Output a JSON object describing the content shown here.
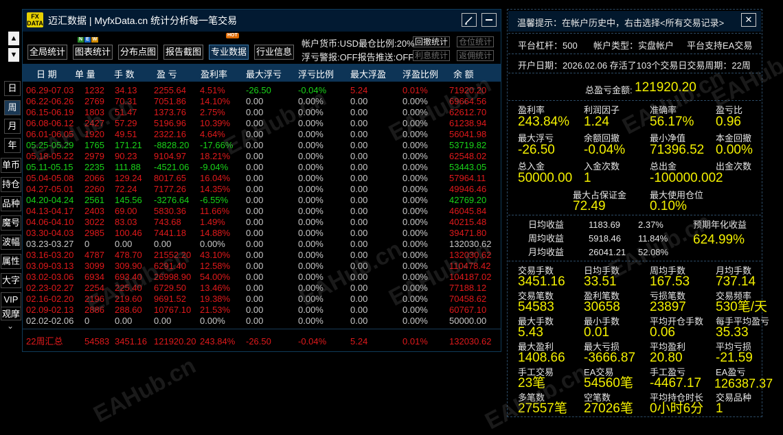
{
  "window": {
    "title": "迈汇数据 | MyfxData.cn  统计分析每一笔交易",
    "logo_text": "FX DATA"
  },
  "toolbar": {
    "buttons": [
      "全局统计",
      "图表统计",
      "分布点图",
      "报告截图",
      "专业数据",
      "行业信息"
    ],
    "new_badge": [
      "N",
      "E",
      "W"
    ],
    "hot_badge": "HOT",
    "currency": "帐户货币:USD最仓比例:20%",
    "warning": "浮亏警报:OFF报告推送:OFF",
    "small_buttons": [
      "回撤统计",
      "仓位统计",
      "利息统计",
      "返佣统计"
    ]
  },
  "sidebar": {
    "up": "▲",
    "down": "▼",
    "items": [
      "日",
      "周",
      "月",
      "年",
      "单币",
      "持仓",
      "品种",
      "魔号",
      "波幅",
      "属性",
      "大字",
      "VIP",
      "观摩"
    ],
    "more": "⌄"
  },
  "table": {
    "headers": [
      "日 期",
      "单 量",
      "手 数",
      "盈 亏",
      "盈利率",
      "最大浮亏",
      "浮亏比例",
      "最大浮盈",
      "浮盈比例",
      "余 额"
    ],
    "rows": [
      {
        "color": "red",
        "date": "06.29-07.03",
        "orders": "1232",
        "lots": "34.13",
        "profit": "2255.64",
        "rate": "4.51%",
        "maxfl": "-26.50",
        "flr": "-0.04%",
        "maxfp": "5.24",
        "fpr": "0.01%",
        "balance": "71920.20"
      },
      {
        "color": "red",
        "date": "06.22-06.26",
        "orders": "2769",
        "lots": "70.31",
        "profit": "7051.86",
        "rate": "14.10%",
        "maxfl": "0.00",
        "flr": "0.00%",
        "maxfp": "0.00",
        "fpr": "0.00%",
        "balance": "69664.56"
      },
      {
        "color": "red",
        "date": "06.15-06.19",
        "orders": "1803",
        "lots": "51.47",
        "profit": "1373.76",
        "rate": "2.75%",
        "maxfl": "0.00",
        "flr": "0.00%",
        "maxfp": "0.00",
        "fpr": "0.00%",
        "balance": "62612.70"
      },
      {
        "color": "red",
        "date": "06.08-06.12",
        "orders": "2427",
        "lots": "57.29",
        "profit": "5196.96",
        "rate": "10.39%",
        "maxfl": "0.00",
        "flr": "0.00%",
        "maxfp": "0.00",
        "fpr": "0.00%",
        "balance": "61238.94"
      },
      {
        "color": "red",
        "date": "06.01-06.05",
        "orders": "1920",
        "lots": "49.51",
        "profit": "2322.16",
        "rate": "4.64%",
        "maxfl": "0.00",
        "flr": "0.00%",
        "maxfp": "0.00",
        "fpr": "0.00%",
        "balance": "56041.98"
      },
      {
        "color": "green",
        "date": "05.25-05.29",
        "orders": "1765",
        "lots": "171.21",
        "profit": "-8828.20",
        "rate": "-17.66%",
        "maxfl": "0.00",
        "flr": "0.00%",
        "maxfp": "0.00",
        "fpr": "0.00%",
        "balance": "53719.82"
      },
      {
        "color": "red",
        "date": "05.18-05.22",
        "orders": "2979",
        "lots": "90.23",
        "profit": "9104.97",
        "rate": "18.21%",
        "maxfl": "0.00",
        "flr": "0.00%",
        "maxfp": "0.00",
        "fpr": "0.00%",
        "balance": "62548.02"
      },
      {
        "color": "green",
        "date": "05.11-05.15",
        "orders": "2235",
        "lots": "111.88",
        "profit": "-4521.06",
        "rate": "-9.04%",
        "maxfl": "0.00",
        "flr": "0.00%",
        "maxfp": "0.00",
        "fpr": "0.00%",
        "balance": "53443.05"
      },
      {
        "color": "red",
        "date": "05.04-05.08",
        "orders": "2066",
        "lots": "129.24",
        "profit": "8017.65",
        "rate": "16.04%",
        "maxfl": "0.00",
        "flr": "0.00%",
        "maxfp": "0.00",
        "fpr": "0.00%",
        "balance": "57964.11"
      },
      {
        "color": "red",
        "date": "04.27-05.01",
        "orders": "2260",
        "lots": "72.24",
        "profit": "7177.26",
        "rate": "14.35%",
        "maxfl": "0.00",
        "flr": "0.00%",
        "maxfp": "0.00",
        "fpr": "0.00%",
        "balance": "49946.46"
      },
      {
        "color": "green",
        "date": "04.20-04.24",
        "orders": "2561",
        "lots": "145.56",
        "profit": "-3276.64",
        "rate": "-6.55%",
        "maxfl": "0.00",
        "flr": "0.00%",
        "maxfp": "0.00",
        "fpr": "0.00%",
        "balance": "42769.20"
      },
      {
        "color": "red",
        "date": "04.13-04.17",
        "orders": "2403",
        "lots": "69.00",
        "profit": "5830.36",
        "rate": "11.66%",
        "maxfl": "0.00",
        "flr": "0.00%",
        "maxfp": "0.00",
        "fpr": "0.00%",
        "balance": "46045.84"
      },
      {
        "color": "red",
        "date": "04.06-04.10",
        "orders": "3022",
        "lots": "83.03",
        "profit": "743.68",
        "rate": "1.49%",
        "maxfl": "0.00",
        "flr": "0.00%",
        "maxfp": "0.00",
        "fpr": "0.00%",
        "balance": "40215.48"
      },
      {
        "color": "red",
        "date": "03.30-04.03",
        "orders": "2985",
        "lots": "100.46",
        "profit": "7441.18",
        "rate": "14.88%",
        "maxfl": "0.00",
        "flr": "0.00%",
        "maxfp": "0.00",
        "fpr": "0.00%",
        "balance": "39471.80"
      },
      {
        "color": "grey",
        "date": "03.23-03.27",
        "orders": "0",
        "lots": "0.00",
        "profit": "0.00",
        "rate": "0.00%",
        "maxfl": "0.00",
        "flr": "0.00%",
        "maxfp": "0.00",
        "fpr": "0.00%",
        "balance": "132030.62"
      },
      {
        "color": "red",
        "date": "03.16-03.20",
        "orders": "4787",
        "lots": "478.70",
        "profit": "21552.20",
        "rate": "43.10%",
        "maxfl": "0.00",
        "flr": "0.00%",
        "maxfp": "0.00",
        "fpr": "0.00%",
        "balance": "132030.62"
      },
      {
        "color": "red",
        "date": "03.09-03.13",
        "orders": "3099",
        "lots": "309.90",
        "profit": "6291.40",
        "rate": "12.58%",
        "maxfl": "0.00",
        "flr": "0.00%",
        "maxfp": "0.00",
        "fpr": "0.00%",
        "balance": "110478.42"
      },
      {
        "color": "red",
        "date": "03.02-03.06",
        "orders": "6934",
        "lots": "693.40",
        "profit": "26998.90",
        "rate": "54.00%",
        "maxfl": "0.00",
        "flr": "0.00%",
        "maxfp": "0.00",
        "fpr": "0.00%",
        "balance": "104187.02"
      },
      {
        "color": "red",
        "date": "02.23-02.27",
        "orders": "2254",
        "lots": "225.40",
        "profit": "6729.50",
        "rate": "13.46%",
        "maxfl": "0.00",
        "flr": "0.00%",
        "maxfp": "0.00",
        "fpr": "0.00%",
        "balance": "77188.12"
      },
      {
        "color": "red",
        "date": "02.16-02.20",
        "orders": "2196",
        "lots": "219.60",
        "profit": "9691.52",
        "rate": "19.38%",
        "maxfl": "0.00",
        "flr": "0.00%",
        "maxfp": "0.00",
        "fpr": "0.00%",
        "balance": "70458.62"
      },
      {
        "color": "red",
        "date": "02.09-02.13",
        "orders": "2886",
        "lots": "288.60",
        "profit": "10767.10",
        "rate": "21.53%",
        "maxfl": "0.00",
        "flr": "0.00%",
        "maxfp": "0.00",
        "fpr": "0.00%",
        "balance": "60767.10"
      },
      {
        "color": "grey",
        "date": "02.02-02.06",
        "orders": "0",
        "lots": "0.00",
        "profit": "0.00",
        "rate": "0.00%",
        "maxfl": "0.00",
        "flr": "0.00%",
        "maxfp": "0.00",
        "fpr": "0.00%",
        "balance": "50000.00"
      }
    ],
    "summary": {
      "date": "22周汇总",
      "orders": "54583",
      "lots": "3451.16",
      "profit": "121920.20",
      "rate": "243.84%",
      "maxfl": "-26.50",
      "flr": "-0.04%",
      "maxfp": "5.24",
      "fpr": "0.01%",
      "balance": "132030.62"
    }
  },
  "panel": {
    "tip": "温馨提示：在帐户历史中，右击选择<所有交易记录>",
    "close": "✕",
    "leverage": "平台杠杆：500",
    "account_type": "帐户类型：实盘帐户",
    "ea_support": "平台支持EA交易",
    "open_date": "开户日期：2026.02.06 存活了103个交易日交易周期：22周",
    "total_profit_label": "总盈亏金额:",
    "total_profit": "121920.20",
    "row1": [
      {
        "label": "盈利率",
        "value": "243.84%"
      },
      {
        "label": "利润因子",
        "value": "1.24"
      },
      {
        "label": "准确率",
        "value": "56.17%"
      },
      {
        "label": "盈亏比",
        "value": "0.96"
      }
    ],
    "row2": [
      {
        "label": "最大浮亏",
        "value": "-26.50"
      },
      {
        "label": "余额回撤",
        "value": "-0.04%"
      },
      {
        "label": "最小净值",
        "value": "71396.52"
      },
      {
        "label": "本金回撤",
        "value": "0.00%"
      }
    ],
    "row3": [
      {
        "label": "总入金",
        "value": "50000.00"
      },
      {
        "label": "入金次数",
        "value": "1"
      },
      {
        "label": "总出金",
        "value": "-100000.00"
      },
      {
        "label": "出金次数",
        "value": "2"
      }
    ],
    "row4": [
      {
        "label": "最大占保证金",
        "value": "72.49"
      },
      {
        "label": "最大使用仓位",
        "value": "0.10%"
      }
    ],
    "daily": [
      {
        "label": "日均收益",
        "amount": "1183.69",
        "pct": "2.37%"
      },
      {
        "label": "周均收益",
        "amount": "5918.46",
        "pct": "11.84%"
      },
      {
        "label": "月均收益",
        "amount": "26041.21",
        "pct": "52.08%"
      }
    ],
    "annual_label": "预期年化收益",
    "annual_value": "624.99%",
    "grid": [
      [
        {
          "label": "交易手数",
          "value": "3451.16"
        },
        {
          "label": "日均手数",
          "value": "33.51"
        },
        {
          "label": "周均手数",
          "value": "167.53"
        },
        {
          "label": "月均手数",
          "value": "737.14"
        }
      ],
      [
        {
          "label": "交易笔数",
          "value": "54583"
        },
        {
          "label": "盈利笔数",
          "value": "30658"
        },
        {
          "label": "亏损笔数",
          "value": "23897"
        },
        {
          "label": "交易频率",
          "value": "530笔/天"
        }
      ],
      [
        {
          "label": "最大手数",
          "value": "5.43"
        },
        {
          "label": "最小手数",
          "value": "0.01"
        },
        {
          "label": "平均开仓手数",
          "value": "0.06"
        },
        {
          "label": "每手平均盈亏",
          "value": "35.33"
        }
      ],
      [
        {
          "label": "最大盈利",
          "value": "1408.66"
        },
        {
          "label": "最大亏损",
          "value": "-3666.87"
        },
        {
          "label": "平均盈利",
          "value": "20.80"
        },
        {
          "label": "平均亏损",
          "value": "-21.59"
        }
      ],
      [
        {
          "label": "手工交易",
          "value": "23笔"
        },
        {
          "label": "EA交易",
          "value": "54560笔"
        },
        {
          "label": "手工盈亏",
          "value": "-4467.17"
        },
        {
          "label": "EA盈亏",
          "value": "126387.37"
        }
      ],
      [
        {
          "label": "多笔数",
          "value": "27557笔"
        },
        {
          "label": "空笔数",
          "value": "27026笔"
        },
        {
          "label": "平均持仓时长",
          "value": "0小时6分"
        },
        {
          "label": "交易品种",
          "value": "1"
        }
      ]
    ]
  },
  "watermark": "EAHub.cn",
  "colors": {
    "profit": "#e0191b",
    "loss": "#19d419",
    "highlight": "#f3f000",
    "header_bg": "#0d3456",
    "title_bg": "#021a32"
  }
}
